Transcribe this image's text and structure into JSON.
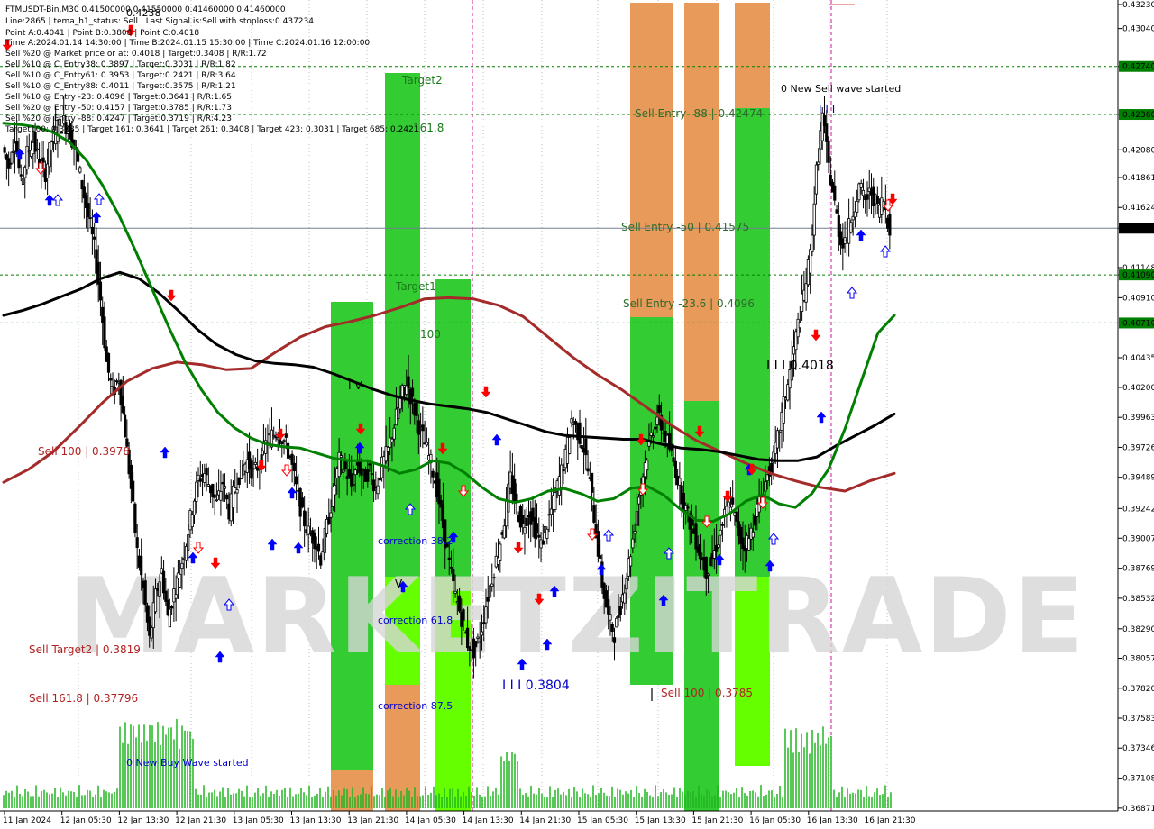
{
  "header": {
    "symbol_line": "FTMUSDT-Bin,M30  0.41500000 0.41550000 0.41460000 0.41460000",
    "lines": [
      "Line:2865 | tema_h1_status: Sell | Last Signal is:Sell with stoploss:0.437234",
      "Point A:0.4041 | Point B:0.3808 | Point C:0.4018",
      "Time A:2024.01.14 14:30:00 | Time B:2024.01.15 15:30:00 | Time C:2024.01.16 12:00:00",
      "Sell %20 @ Market price or at: 0.4018 | Target:0.3408 | R/R:1.72",
      "Sell %10 @ C_Entry38: 0.3897 | Target:0.3031 | R/R:1.82",
      "Sell %10 @ C_Entry61: 0.3953 | Target:0.2421 | R/R:3.64",
      "Sell %10 @ C_Entry88: 0.4011 | Target:0.3575 | R/R:1.21",
      "Sell %10 @ Entry -23: 0.4096 | Target:0.3641 | R/R:1.65",
      "Sell %20 @ Entry -50: 0.4157 | Target:0.3785 | R/R:1.73",
      "Sell %20 @ Entry -88: 0.4247 | Target:0.3719 | R/R:4.23",
      "Target100: 0.3785 | Target 161: 0.3641 | Target 261: 0.3408 | Target 423: 0.3031 | Target 685: 0.2421"
    ],
    "overlap_value": "0.4238"
  },
  "watermark": "MARKETZITRADE",
  "colors": {
    "buy_arrow": "#0000ff",
    "sell_arrow": "#ff0000",
    "ma_green": "#008000",
    "ma_red": "#a52a2a",
    "ma_black": "#000000",
    "band_green": "#33cc33",
    "band_lime": "#66ff00",
    "band_orange": "#e89a5a",
    "level_line_green": "#008000",
    "current_price_line": "#708090",
    "ann_blue": "#0000cd",
    "ann_red": "#b22222"
  },
  "annotations": {
    "target2": "Target2",
    "fib_161": "161.8",
    "target1": "Target1",
    "fib_100": "100",
    "sell_entry_88": "Sell Entry -88 | 0.42474",
    "sell_entry_50": "Sell Entry -50 | 0.41575",
    "sell_entry_23": "Sell Entry -23.6 | 0.4096",
    "new_sell_wave": "0 New Sell wave started",
    "sell_wave_mark": "I I I",
    "point_c": "I I I 0.4018",
    "point_a_mark": "I V",
    "point_b_mark": "V",
    "sell_100_left": "Sell 100 | 0.3978",
    "sell_target2": "Sell Target2 | 0.3819",
    "sell_161": "Sell 161.8 | 0.37796",
    "new_buy_wave": "0 New Buy Wave started",
    "correction_382": "correction 38.2",
    "correction_618": "correction 61.8",
    "correction_875": "correction 87.5",
    "point_b_value": "I I I 0.3804",
    "sell_100_right": "Sell 100 | 0.3785"
  },
  "chart_data": {
    "type": "candlestick",
    "title": "FTMUSDT-Bin,M30",
    "price_axis": {
      "min": 0.3687,
      "max": 0.4323,
      "ticks": [
        "0.43230",
        "0.43040",
        "0.42740",
        "0.42360",
        "0.42080",
        "0.41861",
        "0.41624",
        "0.41460",
        "0.41148",
        "0.41090",
        "0.40910",
        "0.40710",
        "0.40435",
        "0.40200",
        "0.39963",
        "0.39726",
        "0.39489",
        "0.39242",
        "0.39007",
        "0.38769",
        "0.38532",
        "0.38290",
        "0.38057",
        "0.37820",
        "0.37583",
        "0.37346",
        "0.37108",
        "0.36871"
      ],
      "highlighted_levels": [
        {
          "value": 0.4274,
          "label": "0.42740",
          "color": "#008000"
        },
        {
          "value": 0.4236,
          "label": "0.42360",
          "color": "#008000"
        },
        {
          "value": 0.4109,
          "label": "0.41090",
          "color": "#008000"
        },
        {
          "value": 0.4071,
          "label": "0.40710",
          "color": "#008000"
        },
        {
          "value": 0.4146,
          "label": "0.41460",
          "color": "#000000"
        }
      ]
    },
    "time_axis": {
      "labels": [
        "11 Jan 2024",
        "12 Jan 05:30",
        "12 Jan 13:30",
        "12 Jan 21:30",
        "13 Jan 05:30",
        "13 Jan 13:30",
        "13 Jan 21:30",
        "14 Jan 05:30",
        "14 Jan 13:30",
        "14 Jan 21:30",
        "15 Jan 05:30",
        "15 Jan 13:30",
        "15 Jan 21:30",
        "16 Jan 05:30",
        "16 Jan 13:30",
        "16 Jan 21:30"
      ]
    },
    "price_path": [
      0.421,
      0.4195,
      0.422,
      0.418,
      0.4205,
      0.4215,
      0.4198,
      0.419,
      0.4215,
      0.4225,
      0.423,
      0.4222,
      0.4205,
      0.418,
      0.4155,
      0.413,
      0.409,
      0.404,
      0.4015,
      0.4028,
      0.3985,
      0.394,
      0.389,
      0.386,
      0.382,
      0.3855,
      0.3875,
      0.3838,
      0.3858,
      0.3875,
      0.3898,
      0.3925,
      0.3948,
      0.3952,
      0.394,
      0.3928,
      0.3945,
      0.3922,
      0.3942,
      0.3955,
      0.3962,
      0.3952,
      0.396,
      0.3975,
      0.3982,
      0.3985,
      0.3978,
      0.3965,
      0.394,
      0.3918,
      0.3905,
      0.39,
      0.3885,
      0.391,
      0.3935,
      0.3962,
      0.3955,
      0.3942,
      0.396,
      0.3948,
      0.3955,
      0.394,
      0.3958,
      0.397,
      0.399,
      0.401,
      0.4025,
      0.4008,
      0.399,
      0.3975,
      0.396,
      0.394,
      0.391,
      0.388,
      0.3855,
      0.3838,
      0.3818,
      0.3812,
      0.3822,
      0.3848,
      0.387,
      0.389,
      0.3915,
      0.3948,
      0.3925,
      0.391,
      0.3922,
      0.3908,
      0.3895,
      0.3912,
      0.3928,
      0.3948,
      0.3965,
      0.3995,
      0.3985,
      0.3972,
      0.3945,
      0.3905,
      0.3865,
      0.3838,
      0.3825,
      0.3848,
      0.3872,
      0.39,
      0.3935,
      0.396,
      0.3982,
      0.3998,
      0.3985,
      0.3972,
      0.3955,
      0.3935,
      0.3918,
      0.3905,
      0.3888,
      0.3875,
      0.3885,
      0.39,
      0.3918,
      0.393,
      0.391,
      0.3895,
      0.39,
      0.3918,
      0.3935,
      0.395,
      0.3962,
      0.3988,
      0.4015,
      0.404,
      0.407,
      0.4095,
      0.4125,
      0.419,
      0.4235,
      0.4195,
      0.4165,
      0.4135,
      0.414,
      0.416,
      0.4178,
      0.4168,
      0.4175,
      0.4162,
      0.4168,
      0.4146
    ],
    "series": [
      {
        "name": "",
        "color": "#008000",
        "values": [
          0.4229,
          0.4228,
          0.4226,
          0.4222,
          0.4214,
          0.42,
          0.418,
          0.4156,
          0.4128,
          0.4098,
          0.4068,
          0.404,
          0.4018,
          0.4,
          0.3988,
          0.398,
          0.3975,
          0.3973,
          0.3972,
          0.3968,
          0.3964,
          0.3962,
          0.3962,
          0.3958,
          0.3952,
          0.3955,
          0.3962,
          0.396,
          0.3952,
          0.3941,
          0.3932,
          0.3929,
          0.3932,
          0.3938,
          0.394,
          0.3936,
          0.393,
          0.3932,
          0.394,
          0.3942,
          0.3935,
          0.3924,
          0.3915,
          0.3914,
          0.392,
          0.393,
          0.3935,
          0.3928,
          0.3925,
          0.3936,
          0.3955,
          0.3987,
          0.4025,
          0.4063,
          0.4077
        ]
      },
      {
        "name": "",
        "color": "#000000",
        "values": [
          0.4077,
          0.4081,
          0.4086,
          0.4092,
          0.4098,
          0.4106,
          0.4111,
          0.4106,
          0.4095,
          0.4081,
          0.4066,
          0.4054,
          0.4046,
          0.4041,
          0.4039,
          0.4038,
          0.4036,
          0.4031,
          0.4025,
          0.4019,
          0.4014,
          0.401,
          0.4007,
          0.4005,
          0.4003,
          0.4,
          0.3995,
          0.399,
          0.3985,
          0.3982,
          0.3981,
          0.398,
          0.3979,
          0.3979,
          0.3975,
          0.3972,
          0.3971,
          0.3969,
          0.3966,
          0.3963,
          0.3962,
          0.3962,
          0.3965,
          0.3974,
          0.3982,
          0.399,
          0.3999
        ]
      },
      {
        "name": "",
        "color": "#a52a2a",
        "values": [
          0.3945,
          0.3955,
          0.3969,
          0.3988,
          0.4008,
          0.4025,
          0.4035,
          0.404,
          0.4038,
          0.4034,
          0.4035,
          0.4048,
          0.406,
          0.4068,
          0.4072,
          0.4077,
          0.4083,
          0.409,
          0.4091,
          0.409,
          0.4085,
          0.4076,
          0.406,
          0.4044,
          0.403,
          0.4018,
          0.4004,
          0.399,
          0.3978,
          0.3969,
          0.396,
          0.3952,
          0.3946,
          0.3941,
          0.3938,
          0.3946,
          0.3952
        ]
      }
    ],
    "volume_note": "tick volume histogram shown in green at bottom"
  }
}
